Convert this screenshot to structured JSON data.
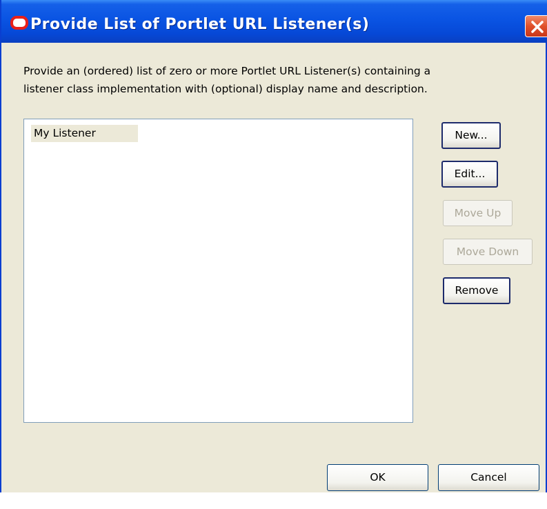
{
  "window": {
    "title": "Provide List of Portlet URL Listener(s)",
    "app_icon": "oracle-icon",
    "close_icon": "close-icon"
  },
  "description": {
    "line1": "Provide an (ordered) list of zero or more Portlet URL Listener(s) containing a",
    "line2": "listener class implementation with (optional) display name and description."
  },
  "listeners": {
    "items": [
      "My Listener"
    ]
  },
  "buttons": {
    "new": "New...",
    "edit": "Edit...",
    "move_up": "Move Up",
    "move_down": "Move Down",
    "remove": "Remove",
    "ok": "OK",
    "cancel": "Cancel"
  },
  "colors": {
    "titlebar": "#0a54e3",
    "dialog_bg": "#ece9d8",
    "close_button": "#e0502a",
    "selection": "#ece9d8"
  }
}
